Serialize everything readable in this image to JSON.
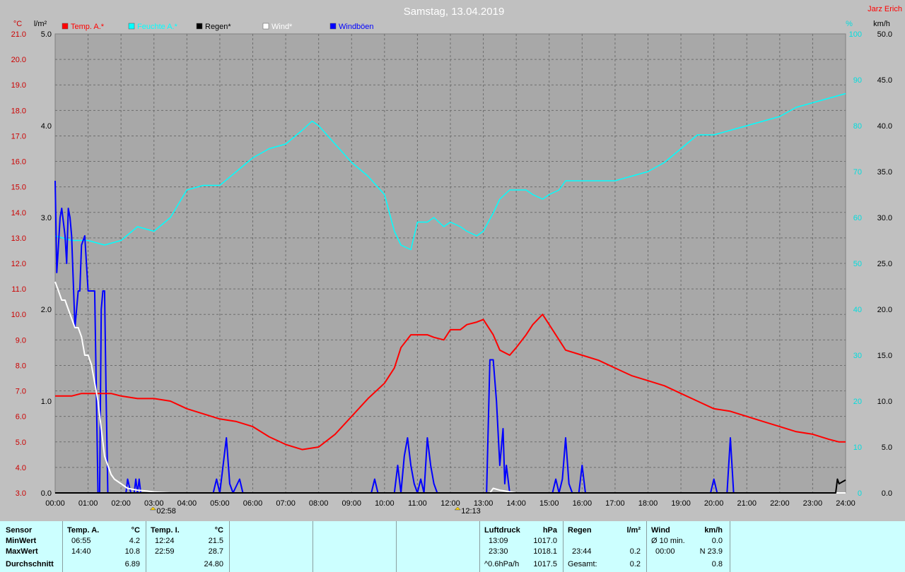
{
  "header": {
    "title": "Samstag, 13.04.2019",
    "author": "Jarz Erich"
  },
  "axes": {
    "temp_unit": "°C",
    "rain_unit": "l/m²",
    "humidity_unit": "%",
    "wind_unit": "km/h",
    "temp_ticks": [
      "21.0",
      "20.0",
      "19.0",
      "18.0",
      "17.0",
      "16.0",
      "15.0",
      "14.0",
      "13.0",
      "12.0",
      "11.0",
      "10.0",
      "9.0",
      "8.0",
      "7.0",
      "6.0",
      "5.0",
      "4.0",
      "3.0"
    ],
    "rain_ticks": [
      "5.0",
      "4.0",
      "3.0",
      "2.0",
      "1.0",
      "0.0"
    ],
    "humidity_ticks": [
      "100",
      "90",
      "80",
      "70",
      "60",
      "50",
      "40",
      "30",
      "20",
      "10",
      "0"
    ],
    "wind_ticks": [
      "50.0",
      "45.0",
      "40.0",
      "35.0",
      "30.0",
      "25.0",
      "20.0",
      "15.0",
      "10.0",
      "5.0",
      "0.0"
    ],
    "time_ticks": [
      "00:00",
      "01:00",
      "02:00",
      "03:00",
      "04:00",
      "05:00",
      "06:00",
      "07:00",
      "08:00",
      "09:00",
      "10:00",
      "11:00",
      "12:00",
      "13:00",
      "14:00",
      "15:00",
      "16:00",
      "17:00",
      "18:00",
      "19:00",
      "20:00",
      "21:00",
      "22:00",
      "23:00",
      "24:00"
    ]
  },
  "legend": [
    {
      "label": "Temp. A.*",
      "color": "#ff0000"
    },
    {
      "label": "Feuchte A.*",
      "color": "#00ffff"
    },
    {
      "label": "Regen*",
      "color": "#000000"
    },
    {
      "label": "Wind*",
      "color": "#ffffff"
    },
    {
      "label": "Windböen",
      "color": "#0000ff"
    }
  ],
  "sun_markers": [
    {
      "label": "02:58",
      "x": 2.97
    },
    {
      "label": "12:13",
      "x": 12.22
    }
  ],
  "chart_data": {
    "type": "line",
    "title": "Samstag, 13.04.2019",
    "x_unit": "hours",
    "xlim": [
      0,
      24
    ],
    "grid": true,
    "legend_placement": "top-left",
    "series": [
      {
        "name": "Temp. A.*",
        "axis": "temp",
        "ylim": [
          3,
          21
        ],
        "color": "#ff0000",
        "x": [
          0,
          0.5,
          0.8,
          1.3,
          1.7,
          2.0,
          2.5,
          3.0,
          3.5,
          4.0,
          4.5,
          5.0,
          5.5,
          6.0,
          6.5,
          7.0,
          7.5,
          8.0,
          8.5,
          9.0,
          9.5,
          10.0,
          10.3,
          10.5,
          10.8,
          11.0,
          11.3,
          11.5,
          11.8,
          12.0,
          12.3,
          12.5,
          12.8,
          13.0,
          13.3,
          13.5,
          13.8,
          14.0,
          14.3,
          14.5,
          14.8,
          15.0,
          15.3,
          15.5,
          16.0,
          16.5,
          17.0,
          17.5,
          18.0,
          18.5,
          19.0,
          19.5,
          20.0,
          20.5,
          21.0,
          21.5,
          22.0,
          22.5,
          23.0,
          23.5,
          23.8,
          24.0
        ],
        "y": [
          6.8,
          6.8,
          6.9,
          6.9,
          6.9,
          6.8,
          6.7,
          6.7,
          6.6,
          6.3,
          6.1,
          5.9,
          5.8,
          5.6,
          5.2,
          4.9,
          4.7,
          4.8,
          5.3,
          6.0,
          6.7,
          7.3,
          7.9,
          8.7,
          9.2,
          9.2,
          9.2,
          9.1,
          9.0,
          9.4,
          9.4,
          9.6,
          9.7,
          9.8,
          9.2,
          8.6,
          8.4,
          8.7,
          9.2,
          9.6,
          10.0,
          9.6,
          9.0,
          8.6,
          8.4,
          8.2,
          7.9,
          7.6,
          7.4,
          7.2,
          6.9,
          6.6,
          6.3,
          6.2,
          6.0,
          5.8,
          5.6,
          5.4,
          5.3,
          5.1,
          5.0,
          5.0
        ]
      },
      {
        "name": "Feuchte A.*",
        "axis": "humidity",
        "ylim": [
          0,
          100
        ],
        "color": "#00ffff",
        "x": [
          0,
          0.5,
          1.0,
          1.5,
          2.0,
          2.5,
          3.0,
          3.5,
          4.0,
          4.5,
          5.0,
          5.5,
          6.0,
          6.5,
          7.0,
          7.5,
          7.8,
          8.0,
          8.5,
          9.0,
          9.5,
          10.0,
          10.3,
          10.5,
          10.8,
          11.0,
          11.3,
          11.5,
          11.8,
          12.0,
          12.3,
          12.5,
          12.8,
          13.0,
          13.3,
          13.5,
          13.8,
          14.0,
          14.3,
          14.5,
          14.8,
          15.0,
          15.3,
          15.5,
          16.0,
          16.5,
          17.0,
          17.5,
          18.0,
          18.5,
          19.0,
          19.5,
          20.0,
          20.5,
          21.0,
          21.5,
          22.0,
          22.5,
          23.0,
          23.5,
          24.0
        ],
        "y": [
          56,
          55,
          55,
          54,
          55,
          58,
          57,
          60,
          66,
          67,
          67,
          70,
          73,
          75,
          76,
          79,
          81,
          80,
          76,
          72,
          69,
          65,
          57,
          54,
          53,
          59,
          59,
          60,
          58,
          59,
          58,
          57,
          56,
          57,
          61,
          64,
          66,
          66,
          66,
          65,
          64,
          65,
          66,
          68,
          68,
          68,
          68,
          69,
          70,
          72,
          75,
          78,
          78,
          79,
          80,
          81,
          82,
          84,
          85,
          86,
          87
        ]
      },
      {
        "name": "Regen*",
        "axis": "rain",
        "ylim": [
          0,
          5
        ],
        "color": "#000000",
        "x": [
          0,
          23.7,
          23.75,
          23.8,
          23.9,
          24.0
        ],
        "y": [
          0,
          0,
          0.15,
          0.1,
          0.12,
          0.14
        ]
      },
      {
        "name": "Wind*",
        "axis": "wind",
        "ylim": [
          0,
          50
        ],
        "color": "#ffffff",
        "x": [
          0,
          0.1,
          0.2,
          0.3,
          0.4,
          0.5,
          0.6,
          0.7,
          0.8,
          0.9,
          1.0,
          1.1,
          1.2,
          1.3,
          1.4,
          1.5,
          1.6,
          1.7,
          1.8,
          2.0,
          2.2,
          2.5,
          2.8,
          3.0,
          3.5,
          13.2,
          13.3,
          13.5,
          14.0,
          24.0
        ],
        "y": [
          23,
          22,
          21,
          21,
          20,
          19,
          18,
          18,
          17,
          15,
          15,
          14,
          12,
          10,
          7,
          4,
          3,
          2,
          1.5,
          1,
          0.5,
          0.3,
          0.2,
          0.1,
          0,
          0,
          0.5,
          0.3,
          0,
          0
        ]
      },
      {
        "name": "Windböen",
        "axis": "wind",
        "ylim": [
          0,
          50
        ],
        "color": "#0000ff",
        "x": [
          0,
          0.05,
          0.1,
          0.15,
          0.2,
          0.3,
          0.35,
          0.4,
          0.45,
          0.5,
          0.6,
          0.7,
          0.75,
          0.8,
          0.9,
          1.0,
          1.1,
          1.2,
          1.3,
          1.35,
          1.4,
          1.45,
          1.5,
          1.55,
          1.6,
          1.65,
          1.7,
          1.75,
          1.8,
          1.85,
          1.9,
          2.0,
          2.1,
          2.15,
          2.2,
          2.3,
          2.35,
          2.4,
          2.45,
          2.5,
          2.55,
          2.6,
          2.7,
          2.8,
          3.0,
          4.8,
          4.9,
          5.0,
          5.2,
          5.3,
          5.4,
          5.6,
          5.7,
          5.8,
          9.6,
          9.7,
          9.8,
          10.3,
          10.4,
          10.5,
          10.6,
          10.7,
          10.8,
          10.9,
          11.0,
          11.1,
          11.2,
          11.3,
          11.4,
          11.5,
          11.6,
          13.0,
          13.1,
          13.2,
          13.3,
          13.4,
          13.5,
          13.6,
          13.65,
          13.7,
          13.8,
          13.9,
          14.0,
          15.1,
          15.2,
          15.3,
          15.4,
          15.5,
          15.6,
          15.7,
          15.8,
          15.9,
          16.0,
          16.1,
          16.2,
          19.9,
          20.0,
          20.1,
          20.4,
          20.5,
          20.6,
          24.0
        ],
        "y": [
          34,
          24,
          27,
          30,
          31,
          28,
          25,
          31,
          30,
          28,
          18,
          22,
          22,
          27,
          28,
          22,
          22,
          22,
          0,
          0,
          20,
          22,
          22,
          10,
          0,
          0,
          0,
          0,
          0,
          0,
          0,
          0,
          0,
          0,
          1.5,
          0,
          0,
          0,
          1.5,
          0,
          1.5,
          0,
          0,
          0,
          0,
          0,
          1.5,
          0,
          6,
          1,
          0,
          1.5,
          0,
          0,
          0,
          1.5,
          0,
          0,
          3,
          0,
          4,
          6,
          3,
          1,
          0,
          1.5,
          0,
          6,
          3,
          1,
          0,
          0,
          0,
          14.5,
          14.5,
          10,
          3,
          7,
          1,
          3,
          0,
          0,
          0,
          0,
          1.5,
          0,
          1.5,
          6,
          1,
          0,
          0,
          0,
          3,
          0,
          0,
          0,
          1.5,
          0,
          0,
          6,
          0,
          0
        ]
      }
    ]
  },
  "stats": {
    "sensor": {
      "header": "Sensor",
      "rows": [
        "MinWert",
        "MaxWert",
        "Durchschnitt"
      ]
    },
    "temp_a": {
      "header": "Temp. A.",
      "unit": "°C",
      "min_time": "06:55",
      "min_val": "4.2",
      "max_time": "14:40",
      "max_val": "10.8",
      "avg": "6.89"
    },
    "temp_i": {
      "header": "Temp. I.",
      "unit": "°C",
      "min_time": "12:24",
      "min_val": "21.5",
      "max_time": "22:59",
      "max_val": "28.7",
      "avg": "24.80"
    },
    "pressure": {
      "header": "Luftdruck",
      "unit": "hPa",
      "min_time": "13:09",
      "min_val": "1017.0",
      "max_time": "23:30",
      "max_val": "1018.1",
      "avg_label": "^0.6hPa/h",
      "avg": "1017.5"
    },
    "rain": {
      "header": "Regen",
      "unit": "l/m²",
      "max_time": "23:44",
      "max_val": "0.2",
      "total_label": "Gesamt:",
      "total": "0.2"
    },
    "wind": {
      "header": "Wind",
      "unit": "km/h",
      "min_label": "Ø 10 min.",
      "min_val": "0.0",
      "max_time": "00:00",
      "max_val": "N 23.9",
      "avg": "0.8"
    }
  }
}
